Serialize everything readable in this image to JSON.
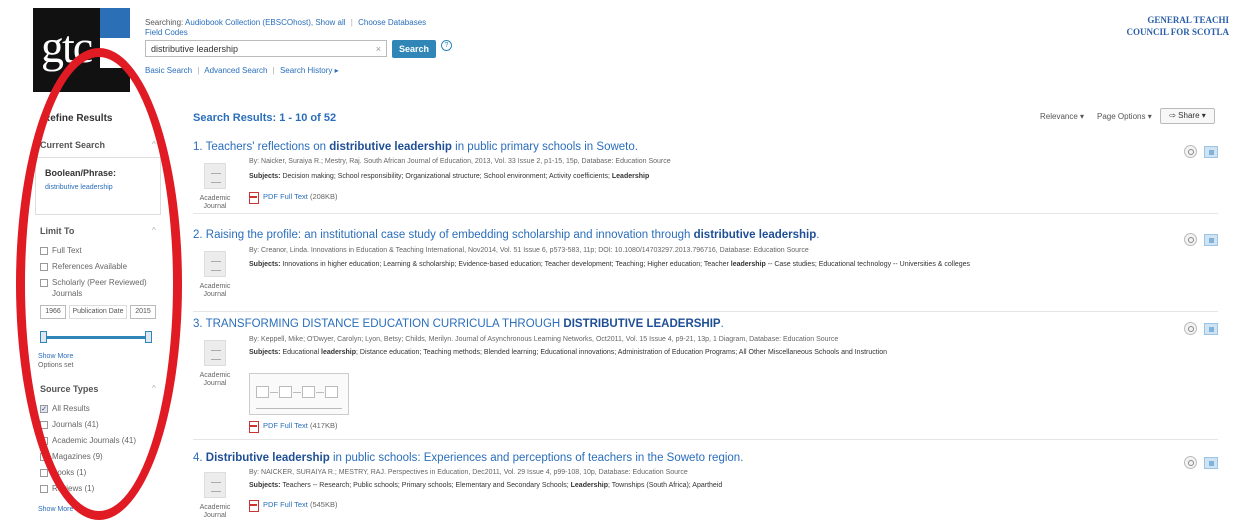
{
  "header": {
    "logo_text": "gtc",
    "searching_label": "Searching:",
    "searching_db": "Audiobook Collection (EBSCOhost), Show all",
    "choose_db": "Choose Databases",
    "field_codes": "Field Codes",
    "search_value": "distributive leadership",
    "clear": "×",
    "search_button": "Search",
    "help": "?",
    "links": [
      "Basic Search",
      "Advanced Search",
      "Search History ▸"
    ],
    "org_line1": "GENERAL TEACHI",
    "org_line2": "COUNCIL FOR SCOTLA"
  },
  "left_panel": {
    "title": "Refine Results",
    "current_search_head": "Current Search",
    "boolean_label": "Boolean/Phrase:",
    "boolean_value": "distributive leadership",
    "limit_to_head": "Limit To",
    "limit_options": [
      "Full Text",
      "References Available",
      "Scholarly (Peer Reviewed)",
      "Journals"
    ],
    "date_from": "1966",
    "date_label": "Publication Date",
    "date_to": "2015",
    "show_more": "Show More",
    "options_set": "Options set",
    "source_types_head": "Source Types",
    "source_options": [
      "All Results",
      "Journals (41)",
      "Academic Journals (41)",
      "Magazines (9)",
      "Books (1)",
      "Reviews (1)"
    ],
    "show_more_2": "Show More",
    "collapse": "^"
  },
  "results": {
    "title_prefix": "Search Results:",
    "title_range": "1 - 10 of 52",
    "relevance": "Relevance ▾",
    "page_options": "Page Options ▾",
    "share": "Share ▾",
    "doc_type_line1": "Academic",
    "doc_type_line2": "Journal",
    "subjects_label": "Subjects:",
    "items": [
      {
        "num": "1.",
        "title_a": "Teachers' reflections on ",
        "title_b": "distributive leadership",
        "title_c": " in public primary schools in Soweto.",
        "meta": "By: Naicker, Suraiya R.; Mestry, Raj. South African Journal of Education, 2013, Vol. 33 Issue 2, p1-15, 15p, Database: Education Source",
        "subjects": "Decision making; School responsibility; Organizational structure; School environment; Activity coefficients; ",
        "subjects_bold": "Leadership",
        "subjects_tail": "",
        "pdf": "PDF Full Text",
        "size": "(208KB)"
      },
      {
        "num": "2.",
        "title_a": "Raising the profile: an institutional case study of embedding scholarship and innovation through ",
        "title_b": "distributive leadership",
        "title_c": ".",
        "meta": "By: Creanor, Linda. Innovations in Education & Teaching International, Nov2014, Vol. 51 Issue 6, p573-583, 11p; DOI: 10.1080/14703297.2013.796716, Database: Education Source",
        "subjects": "Innovations in higher education; Learning & scholarship; Evidence-based education; Teacher development; Teaching; Higher education; Teacher ",
        "subjects_bold": "leadership",
        "subjects_tail": " -- Case studies; Educational technology -- Universities & colleges"
      },
      {
        "num": "3.",
        "title_a": "TRANSFORMING DISTANCE EDUCATION CURRICULA THROUGH ",
        "title_b": "DISTRIBUTIVE LEADERSHIP",
        "title_c": ".",
        "meta": "By: Keppell, Mike; O'Dwyer, Carolyn; Lyon, Betsy; Childs, Merilyn. Journal of Asynchronous Learning Networks, Oct2011, Vol. 15 Issue 4, p9-21, 13p, 1 Diagram, Database: Education Source",
        "subjects": "Educational ",
        "subjects_bold": "leadership",
        "subjects_tail": "; Distance education; Teaching methods; Blended learning; Educational innovations; Administration of Education Programs; All Other Miscellaneous Schools and Instruction",
        "pdf": "PDF Full Text",
        "size": "(417KB)"
      },
      {
        "num": "4.",
        "title_a": "",
        "title_b": "Distributive leadership",
        "title_c": " in public schools: Experiences and perceptions of teachers in the Soweto region.",
        "meta": "By: NAICKER, SURAIYA R.; MESTRY, RAJ. Perspectives in Education, Dec2011, Vol. 29 Issue 4, p99-108, 10p, Database: Education Source",
        "subjects": "Teachers -- Research; Public schools; Primary schools; Elementary and Secondary Schools; ",
        "subjects_bold": "Leadership",
        "subjects_tail": "; Townships (South Africa); Apartheid",
        "pdf": "PDF Full Text",
        "size": "(545KB)"
      }
    ]
  },
  "colors": {
    "accent": "#2f86b7",
    "link": "#2a6ebb",
    "annotation": "#e01b24"
  }
}
